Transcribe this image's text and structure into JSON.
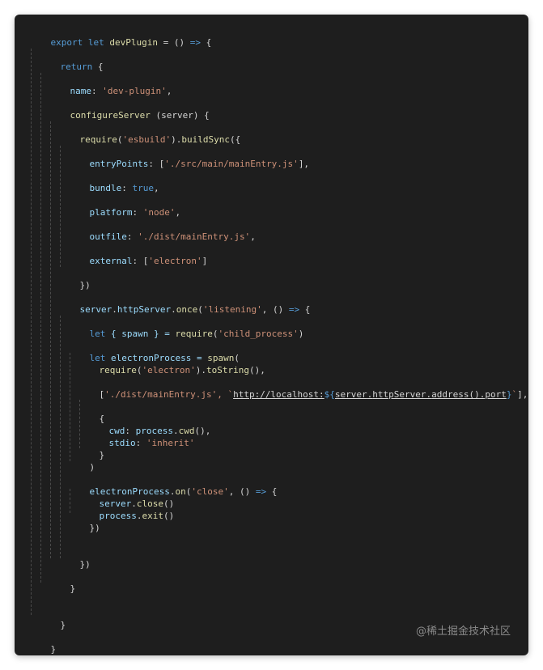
{
  "code": {
    "l1": [
      "export",
      " ",
      "let",
      " ",
      "devPlugin",
      " = () ",
      "=>",
      " {"
    ],
    "l2": [
      "return",
      " {"
    ],
    "l3": [
      "name",
      ": ",
      "'dev-plugin'",
      ","
    ],
    "l4": [
      "configureServer",
      " (server) {"
    ],
    "l5": [
      "require",
      "(",
      "'esbuild'",
      ").",
      "buildSync",
      "({"
    ],
    "l6": [
      "entryPoints",
      ": [",
      "'./src/main/mainEntry.js'",
      "],"
    ],
    "l7": [
      "bundle",
      ": ",
      "true",
      ","
    ],
    "l8": [
      "platform",
      ": ",
      "'node'",
      ","
    ],
    "l9": [
      "outfile",
      ": ",
      "'./dist/mainEntry.js'",
      ","
    ],
    "l10": [
      "external",
      ": [",
      "'electron'",
      "]"
    ],
    "l11": [
      "})"
    ],
    "l12": [
      "server",
      ".",
      "httpServer",
      ".",
      "once",
      "(",
      "'listening'",
      ", () ",
      "=>",
      " {"
    ],
    "l13": [
      "let",
      " { spawn } = ",
      "require",
      "(",
      "'child_process'",
      ")"
    ],
    "l14": [
      "let",
      " electronProcess = ",
      "spawn",
      "("
    ],
    "l15": [
      "require",
      "(",
      "'electron'",
      ").",
      "toString",
      "(),"
    ],
    "l16": [
      "[",
      "'./dist/mainEntry.js'",
      ", `",
      "http://localhost:",
      "${",
      "server",
      ".",
      "httpServer",
      ".",
      "address",
      "().",
      "port",
      "}",
      "`",
      "],"
    ],
    "l17": [
      "{"
    ],
    "l18": [
      "cwd",
      ": ",
      "process",
      ".",
      "cwd",
      "(),"
    ],
    "l19": [
      "stdio",
      ": ",
      "'inherit'"
    ],
    "l20": [
      "}"
    ],
    "l21": [
      ")"
    ],
    "l22": [
      "electronProcess",
      ".",
      "on",
      "(",
      "'close'",
      ", () ",
      "=>",
      " {"
    ],
    "l23": [
      "server",
      ".",
      "close",
      "()"
    ],
    "l24": [
      "process",
      ".",
      "exit",
      "()"
    ],
    "l25": [
      "})"
    ],
    "l26": [
      "})"
    ],
    "l27": [
      "}"
    ],
    "l28": [
      "}"
    ],
    "l29": [
      "}"
    ]
  },
  "watermark": "@稀土掘金技术社区",
  "colors": {
    "background": "#1e1e1e",
    "keyword": "#569cd6",
    "function": "#dcdcaa",
    "string": "#ce9178",
    "property": "#9cdcfe",
    "text": "#d4d4d4"
  }
}
